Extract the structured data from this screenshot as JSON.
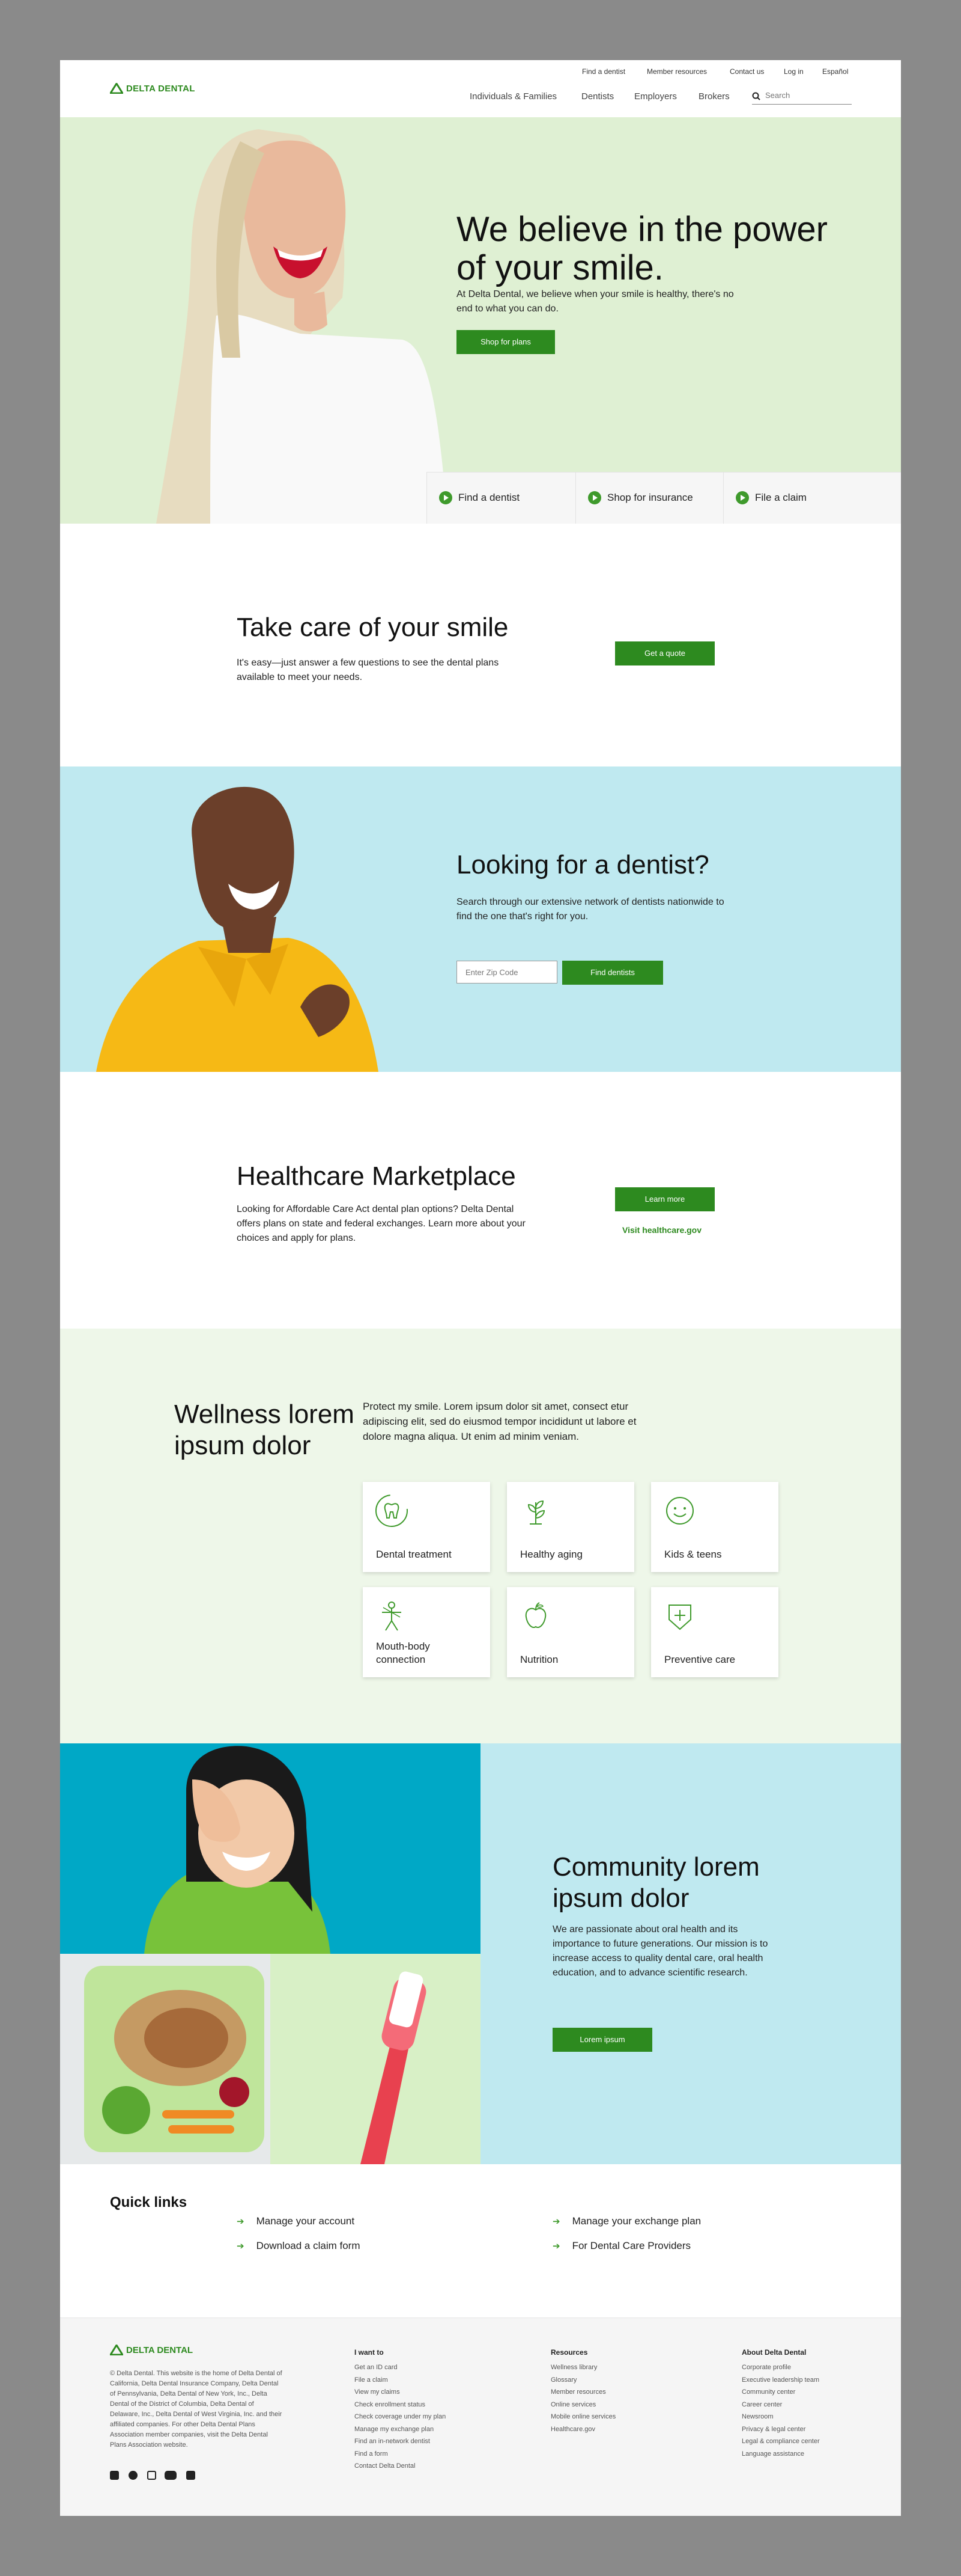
{
  "header": {
    "logo": "DELTA DENTAL",
    "utility_links": [
      "Find a dentist",
      "Member resources",
      "Contact us",
      "Log in",
      "Español"
    ],
    "main_nav": [
      "Individuals & Families",
      "Dentists",
      "Employers",
      "Brokers"
    ],
    "search_placeholder": "Search"
  },
  "hero": {
    "title": "We believe in the power of your smile.",
    "text": "At Delta Dental, we believe when your smile is healthy, there's no end to what you can do.",
    "cta": "Shop for plans",
    "tabs": [
      "Find a dentist",
      "Shop for insurance",
      "File a claim"
    ]
  },
  "smile": {
    "title": "Take care of your smile",
    "text": "It's easy—just answer a few questions to see the dental plans available to meet your needs.",
    "cta": "Get a quote"
  },
  "dentist": {
    "title": "Looking for a dentist?",
    "text": "Search through our extensive network of dentists nationwide to find the one that's right for you.",
    "zip_placeholder": "Enter Zip Code",
    "cta": "Find dentists"
  },
  "marketplace": {
    "title": "Healthcare Marketplace",
    "text": "Looking for Affordable Care Act dental plan options? Delta Dental offers plans on state and federal exchanges. Learn more about your choices and apply for plans.",
    "cta": "Learn more",
    "link": "Visit healthcare.gov"
  },
  "wellness": {
    "title": "Wellness lorem ipsum dolor",
    "text": "Protect my smile. Lorem ipsum dolor sit amet, consect etur adipiscing elit, sed do eiusmod tempor incididunt ut labore et dolore magna aliqua. Ut enim ad minim veniam.",
    "cards": [
      {
        "label": "Dental treatment",
        "icon": "tooth-icon"
      },
      {
        "label": "Healthy aging",
        "icon": "sprout-icon"
      },
      {
        "label": "Kids & teens",
        "icon": "smiley-icon"
      },
      {
        "label": "Mouth-body connection",
        "icon": "body-icon"
      },
      {
        "label": "Nutrition",
        "icon": "apple-icon"
      },
      {
        "label": "Preventive care",
        "icon": "shield-plus-icon"
      }
    ]
  },
  "community": {
    "title": "Community lorem ipsum dolor",
    "text": "We are passionate about oral health and its importance to future generations. Our mission is to increase access to quality dental care, oral health education, and to advance scientific research.",
    "cta": "Lorem ipsum"
  },
  "quick_links": {
    "title": "Quick links",
    "items": [
      "Manage your account",
      "Download a claim form",
      "Manage your exchange plan",
      "For Dental Care Providers"
    ]
  },
  "footer": {
    "logo": "DELTA DENTAL",
    "legal": "© Delta Dental. This website is the home of Delta Dental of California, Delta Dental Insurance Company, Delta Dental of Pennsylvania, Delta Dental of New York, Inc., Delta Dental of the District of Columbia, Delta Dental of Delaware, Inc., Delta Dental of West Virginia, Inc. and their affiliated companies. For other Delta Dental Plans Association member companies, visit the Delta Dental Plans Association website.",
    "columns": [
      {
        "title": "I want to",
        "links": [
          "Get an ID card",
          "File a claim",
          "View my claims",
          "Check enrollment status",
          "Check coverage under my plan",
          "Manage my exchange plan",
          "Find an in-network dentist",
          "Find a form",
          "Contact Delta Dental"
        ]
      },
      {
        "title": "Resources",
        "links": [
          "Wellness library",
          "Glossary",
          "Member resources",
          "Online services",
          "Mobile online services",
          "Healthcare.gov"
        ]
      },
      {
        "title": "About Delta Dental",
        "links": [
          "Corporate profile",
          "Executive leadership team",
          "Community center",
          "Career center",
          "Newsroom",
          "Privacy & legal center",
          "Legal & compliance center",
          "Language assistance"
        ]
      }
    ],
    "social": [
      "facebook-icon",
      "twitter-icon",
      "instagram-icon",
      "youtube-icon",
      "linkedin-icon"
    ]
  },
  "colors": {
    "brand_green": "#2d8a1f",
    "hero_bg": "#dff0d3",
    "dentist_bg": "#bfe9f0",
    "wellness_bg": "#eef7e9"
  }
}
